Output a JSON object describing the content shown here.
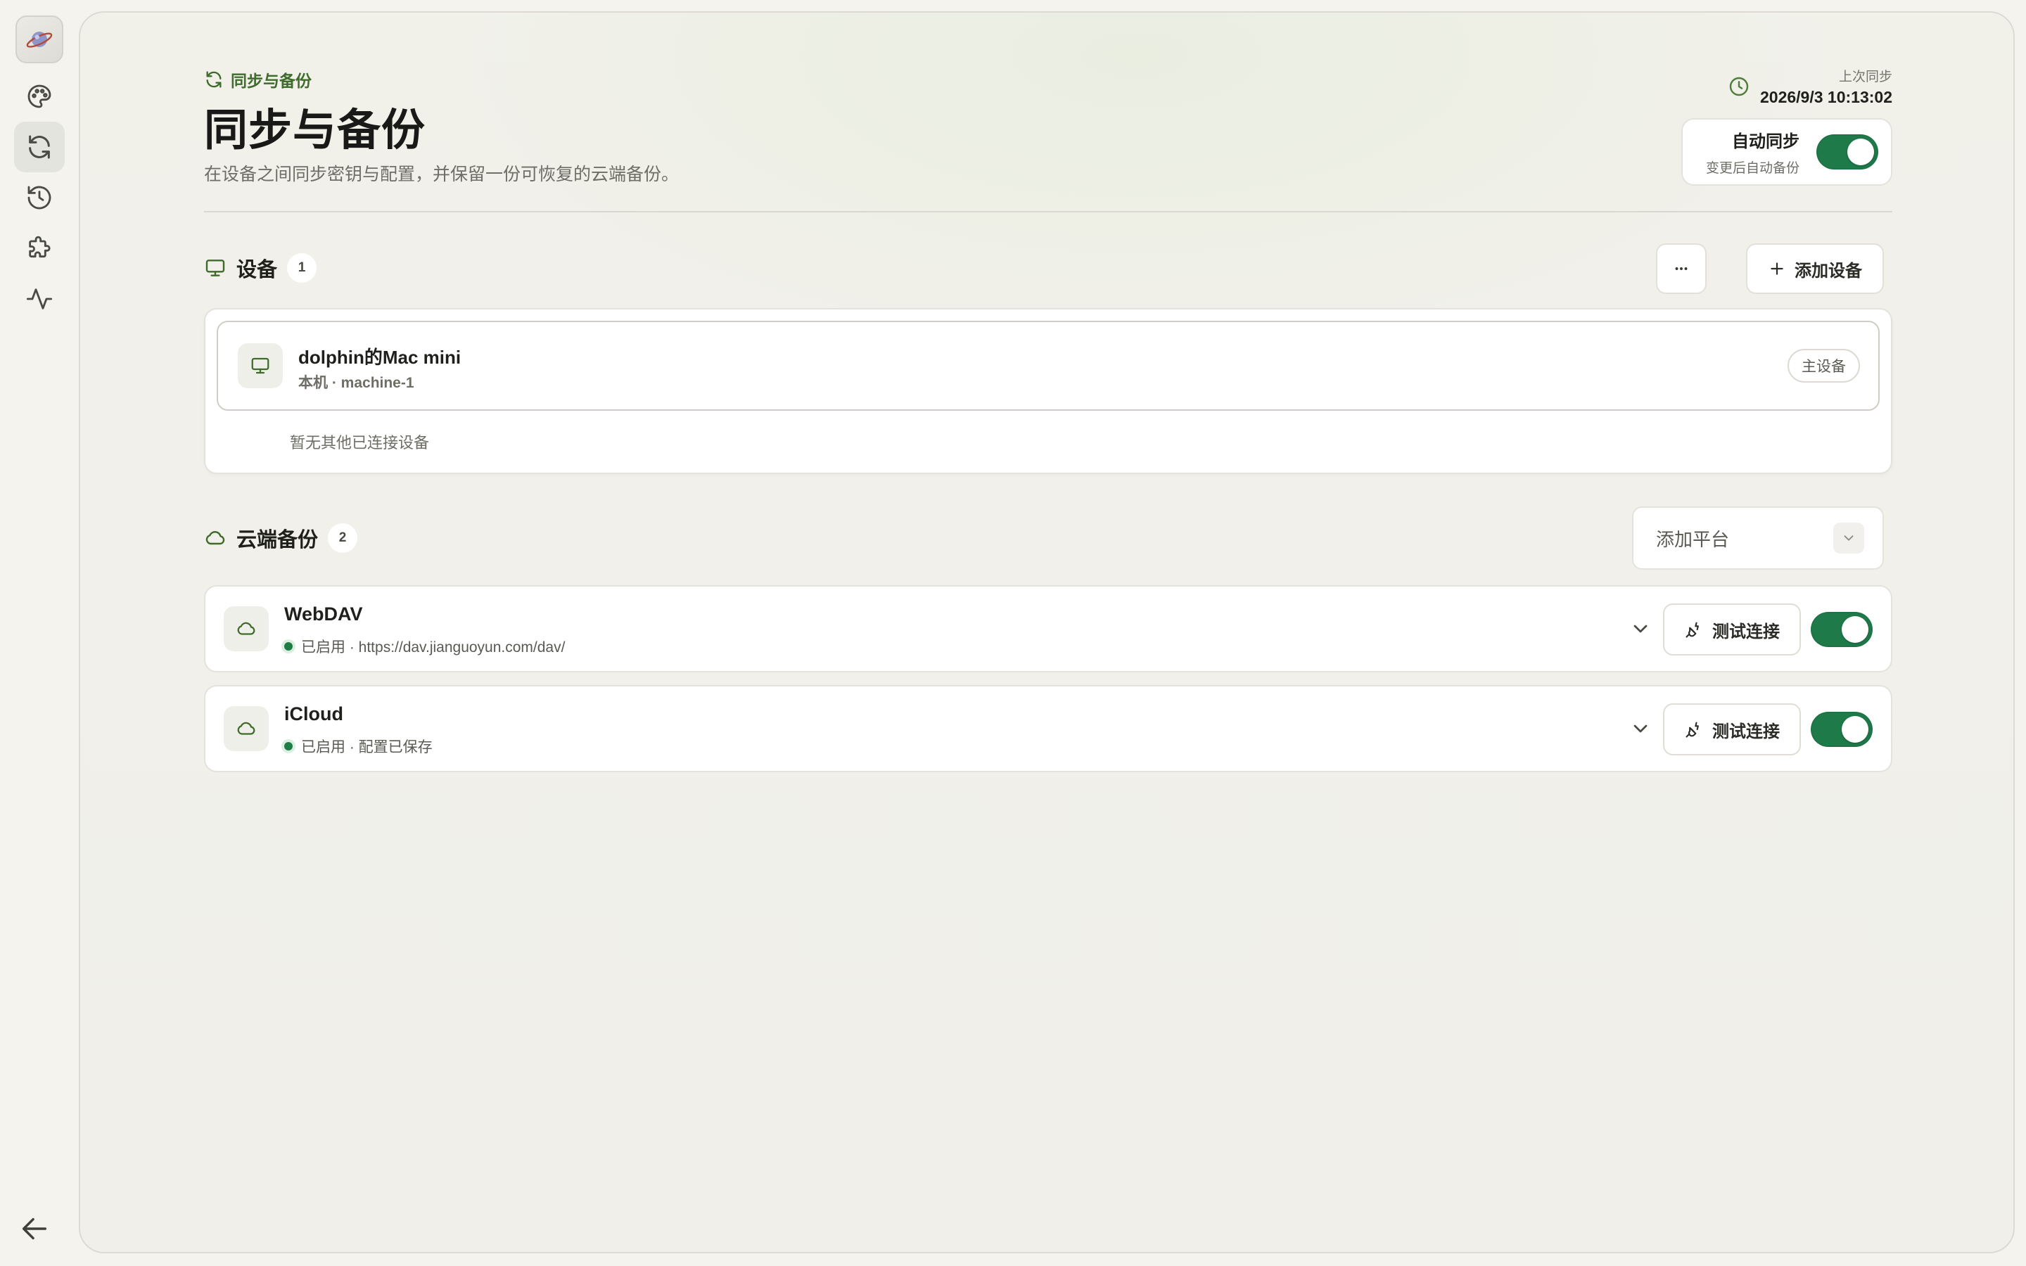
{
  "header": {
    "breadcrumb": "同步与备份",
    "title": "同步与备份",
    "subtitle": "在设备之间同步密钥与配置，并保留一份可恢复的云端备份。",
    "last_sync_label": "上次同步",
    "last_sync_time": "2026/9/3 10:13:02",
    "auto_sync": {
      "title": "自动同步",
      "subtitle": "变更后自动备份",
      "enabled": true
    }
  },
  "sidebar": {
    "items": [
      {
        "name": "palette-icon",
        "active": false
      },
      {
        "name": "sync-icon",
        "active": true
      },
      {
        "name": "history-icon",
        "active": false
      },
      {
        "name": "puzzle-icon",
        "active": false
      },
      {
        "name": "activity-icon",
        "active": false
      }
    ]
  },
  "devices": {
    "title": "设备",
    "count": "1",
    "add_label": "添加设备",
    "list": [
      {
        "name": "dolphin的Mac mini",
        "meta": "本机 · machine-1",
        "tag": "主设备"
      }
    ],
    "empty_text": "暂无其他已连接设备"
  },
  "cloud": {
    "title": "云端备份",
    "count": "2",
    "select_value": "添加平台",
    "platforms": [
      {
        "name": "WebDAV",
        "status": "已启用 · https://dav.jianguoyun.com/dav/",
        "test_label": "测试连接",
        "enabled": true
      },
      {
        "name": "iCloud",
        "status": "已启用 · 配置已保存",
        "test_label": "测试连接",
        "enabled": true
      }
    ]
  },
  "colors": {
    "accent": "#1f7a4a",
    "icon_green": "#3e6b2a",
    "background": "#f4f3ee"
  }
}
